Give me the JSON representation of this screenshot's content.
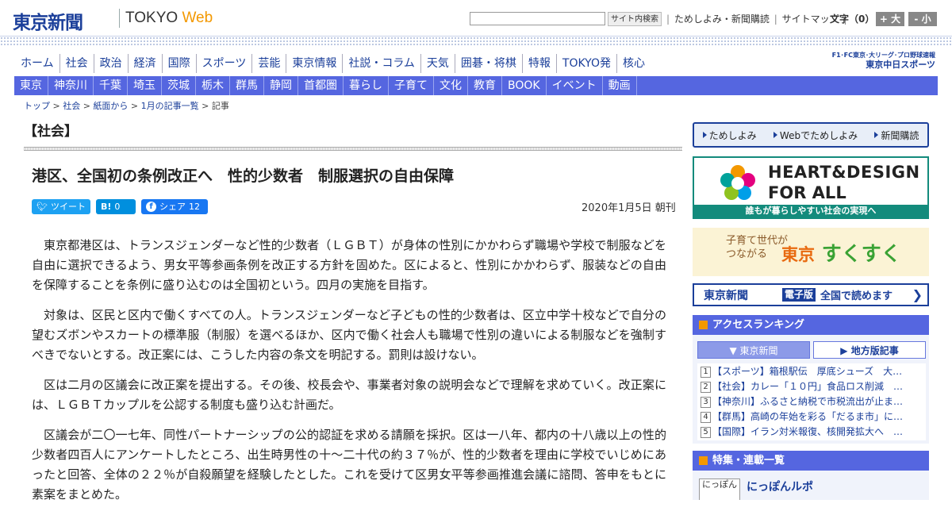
{
  "header": {
    "logo": "東京新聞",
    "logo_tokyo": "TOKYO ",
    "logo_web": "Web",
    "search_button": "サイト内検索",
    "util_links": [
      "ためしよみ・新聞購読",
      "サイトマップ"
    ],
    "font_label": "文字（0）",
    "font_large": "+ 大",
    "font_small": "- 小"
  },
  "main_nav": [
    "ホーム",
    "社会",
    "政治",
    "経済",
    "国際",
    "スポーツ",
    "芸能",
    "東京情報",
    "社説・コラム",
    "天気",
    "囲碁・将棋",
    "特報",
    "TOKYO発",
    "核心"
  ],
  "sports_logo": {
    "top": "F1･FC東京･大リーグ･プロ野球速報",
    "name": "東京中日スポーツ"
  },
  "local_nav": [
    "東京",
    "神奈川",
    "千葉",
    "埼玉",
    "茨城",
    "栃木",
    "群馬",
    "静岡",
    "首都圏",
    "暮らし",
    "子育て",
    "文化",
    "教育",
    "BOOK",
    "イベント",
    "動画"
  ],
  "breadcrumb": [
    "トップ",
    "社会",
    "紙面から",
    "1月の記事一覧",
    "記事"
  ],
  "section_title": "【社会】",
  "headline": "港区、全国初の条例改正へ　性的少数者　制服選択の自由保障",
  "share": {
    "tweet": "ツイート",
    "hatena_label": "B!",
    "hatena_count": "0",
    "fb_label": "シェア",
    "fb_count": "12"
  },
  "pubdate": "2020年1月5日 朝刊",
  "article": [
    "東京都港区は、トランスジェンダーなど性的少数者（ＬＧＢＴ）が身体の性別にかかわらず職場や学校で制服などを自由に選択できるよう、男女平等参画条例を改正する方針を固めた。区によると、性別にかかわらず、服装などの自由を保障することを条例に盛り込むのは全国初という。四月の実施を目指す。",
    "対象は、区民と区内で働くすべての人。トランスジェンダーなど子どもの性的少数者は、区立中学十校などで自分の望むズボンやスカートの標準服（制服）を選べるほか、区内で働く社会人も職場で性別の違いによる制服などを強制すべきでないとする。改正案には、こうした内容の条文を明記する。罰則は設けない。",
    "区は二月の区議会に改正案を提出する。その後、校長会や、事業者対象の説明会などで理解を求めていく。改正案には、ＬＧＢＴカップルを公認する制度も盛り込む計画だ。",
    "区議会が二〇一七年、同性パートナーシップの公的認証を求める請願を採択。区は一八年、都内の十八歳以上の性的少数者四百人にアンケートしたところ、出生時男性の十～二十代の約３７％が、性的少数者を理由に学校でいじめにあったと回答、全体の２２％が自殺願望を経験したとした。これを受けて区男女平等参画推進会議に諮問、答申をもとに素案をまとめた。"
  ],
  "sidebar": {
    "promo": [
      "ためしよみ",
      "Webでためしよみ",
      "新聞購読"
    ],
    "heart_line1": "HEART&DESIGN",
    "heart_line2": "FOR ALL",
    "heart_foot": "誰もが暮らしやすい社会の実現へ",
    "suku_small": "子育て世代が\nつながる",
    "suku_tokyo": "東京",
    "suku_big": "すくすく",
    "epaper_name": "東京新聞",
    "epaper_badge": "電子版",
    "epaper_text": "全国で読めます",
    "ranking_title": "アクセスランキング",
    "ranking_tab1": "東京新聞",
    "ranking_tab2": "地方版記事",
    "ranking": [
      "【スポーツ】箱根駅伝　厚底シューズ　大…",
      "【社会】カレー「１０円」食品ロス削減　…",
      "【神奈川】ふるさと納税で市税流出が止ま…",
      "【群馬】高崎の年始を彩る「だるま市」に…",
      "【国際】イラン対米報復、核開発拡大へ　…"
    ],
    "feature_title": "特集・連載一覧",
    "feature_thumb": "にっぽん",
    "feature_item": "にっぽんルポ"
  },
  "colors": {
    "brand": "#1b3f9a",
    "localnav": "#5566e0",
    "accent": "#f39800",
    "heart": "#138b7c"
  }
}
